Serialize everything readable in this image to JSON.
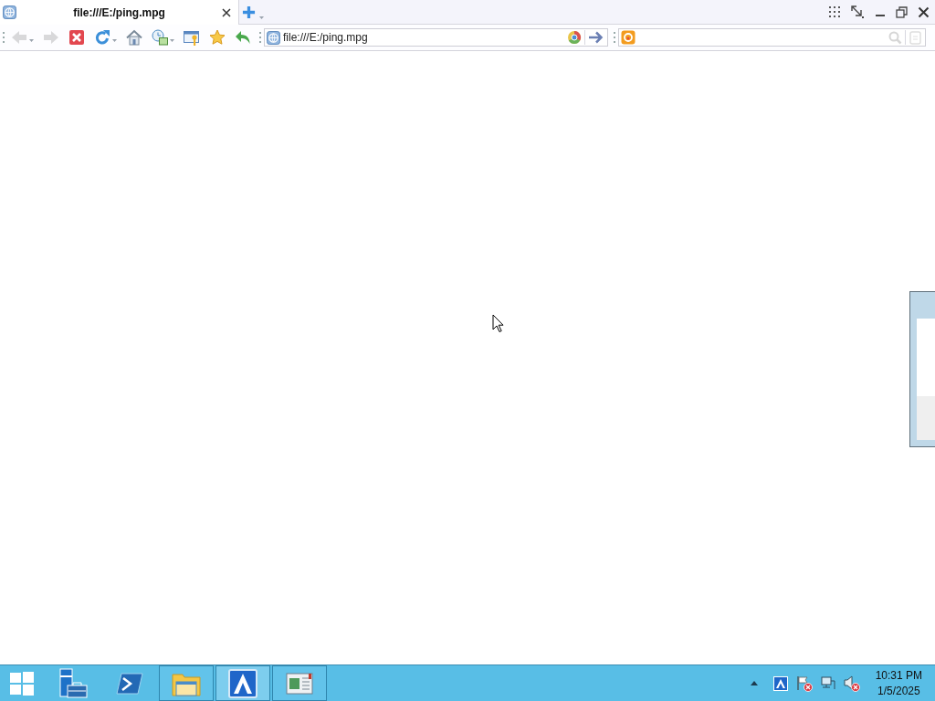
{
  "tabs": [
    {
      "title": "file:///E:/ping.mpg",
      "selected": true
    }
  ],
  "toolbar": [
    {
      "kind": "back",
      "disabled": true,
      "menu": true
    },
    {
      "kind": "forward",
      "disabled": true,
      "menu": false
    },
    {
      "kind": "stop",
      "disabled": false,
      "menu": false
    },
    {
      "kind": "refresh",
      "disabled": false,
      "menu": true
    },
    {
      "kind": "home",
      "disabled": false,
      "menu": false
    },
    {
      "kind": "history",
      "disabled": false,
      "menu": true
    },
    {
      "kind": "window",
      "disabled": false,
      "menu": false
    },
    {
      "kind": "favorites",
      "disabled": false,
      "menu": false
    },
    {
      "kind": "undo",
      "disabled": false,
      "menu": false
    }
  ],
  "address_bar": {
    "value": "file:///E:/ping.mpg"
  },
  "taskbar": {
    "items": [
      {
        "kind": "start",
        "running": false,
        "selected": false
      },
      {
        "kind": "server-manager",
        "running": false,
        "selected": false
      },
      {
        "kind": "powershell",
        "running": false,
        "selected": false
      },
      {
        "kind": "explorer",
        "running": true,
        "selected": false
      },
      {
        "kind": "browser",
        "running": true,
        "selected": true
      },
      {
        "kind": "document",
        "running": true,
        "selected": false
      }
    ],
    "tray": [
      {
        "kind": "show-hidden",
        "alert": false
      },
      {
        "kind": "browser",
        "alert": false
      },
      {
        "kind": "flag",
        "alert": true
      },
      {
        "kind": "network",
        "alert": false
      },
      {
        "kind": "volume",
        "alert": true
      }
    ],
    "clock": {
      "time": "10:31 PM",
      "date": "1/5/2025"
    }
  }
}
